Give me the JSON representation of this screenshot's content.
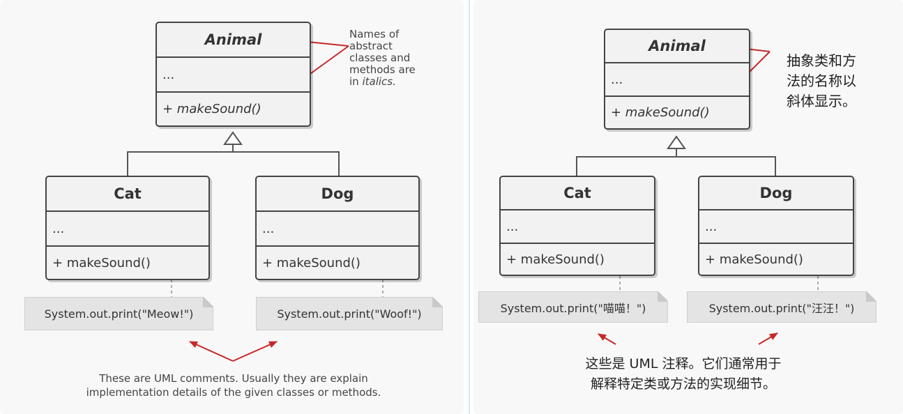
{
  "left": {
    "abstract_class": {
      "name": "Animal",
      "fields": "...",
      "method": "+ makeSound()"
    },
    "cat": {
      "name": "Cat",
      "fields": "...",
      "method": "+ makeSound()",
      "note": "System.out.print(\"Meow!\")"
    },
    "dog": {
      "name": "Dog",
      "fields": "...",
      "method": "+ makeSound()",
      "note": "System.out.print(\"Woof!\")"
    },
    "side_annotation_lines": [
      "Names of",
      "abstract",
      "classes and",
      "methods are"
    ],
    "side_annotation_prefix": "in ",
    "side_annotation_italic": "italics.",
    "bottom_annotation_lines": [
      "These are UML comments. Usually they are explain",
      "implementation details of the given classes or methods."
    ]
  },
  "right": {
    "abstract_class": {
      "name": "Animal",
      "fields": "...",
      "method": "+ makeSound()"
    },
    "cat": {
      "name": "Cat",
      "fields": "...",
      "method": "+ makeSound()",
      "note": "System.out.print(\"喵喵！\")"
    },
    "dog": {
      "name": "Dog",
      "fields": "...",
      "method": "+ makeSound()",
      "note": "System.out.print(\"汪汪！\")"
    },
    "side_annotation_lines": [
      "抽象类和方",
      "法的名称以",
      "斜体显示。"
    ],
    "bottom_annotation_lines": [
      "这些是 UML 注释。它们通常用于",
      "解释特定类或方法的实现细节。"
    ]
  },
  "colors": {
    "arrow": "#c62828",
    "border": "#444444",
    "box_fill": "#f2f2f2",
    "note_fill": "#e4e4e4",
    "divider": "#d8e6f4"
  }
}
